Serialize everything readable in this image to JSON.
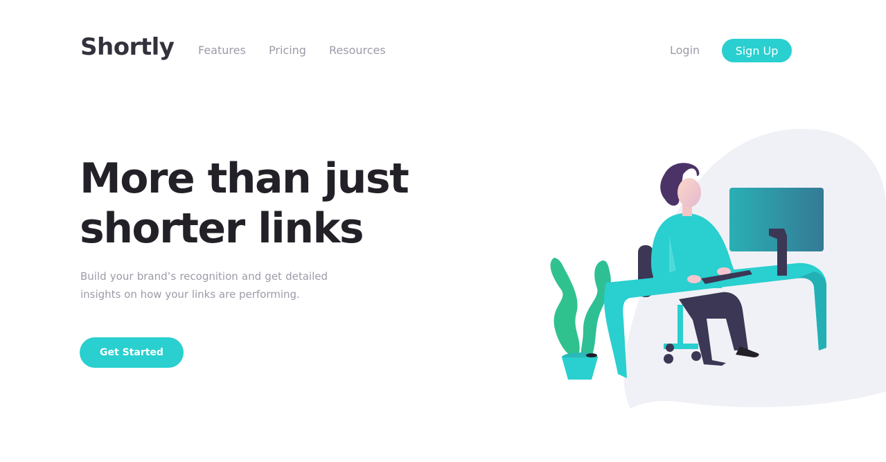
{
  "header": {
    "logo": "Shortly",
    "nav": {
      "features": "Features",
      "pricing": "Pricing",
      "resources": "Resources"
    },
    "login": "Login",
    "signup": "Sign Up"
  },
  "hero": {
    "title": "More than just shorter links",
    "subtitle": "Build your brand’s recognition and get detailed insights on how your links are performing.",
    "cta": "Get Started"
  },
  "colors": {
    "primary": "#2acfcf",
    "dark_text": "#232127",
    "gray_text": "#9e9aa8",
    "blob": "#f0f1f6"
  },
  "illustration": "person-working-at-desk-illustration"
}
